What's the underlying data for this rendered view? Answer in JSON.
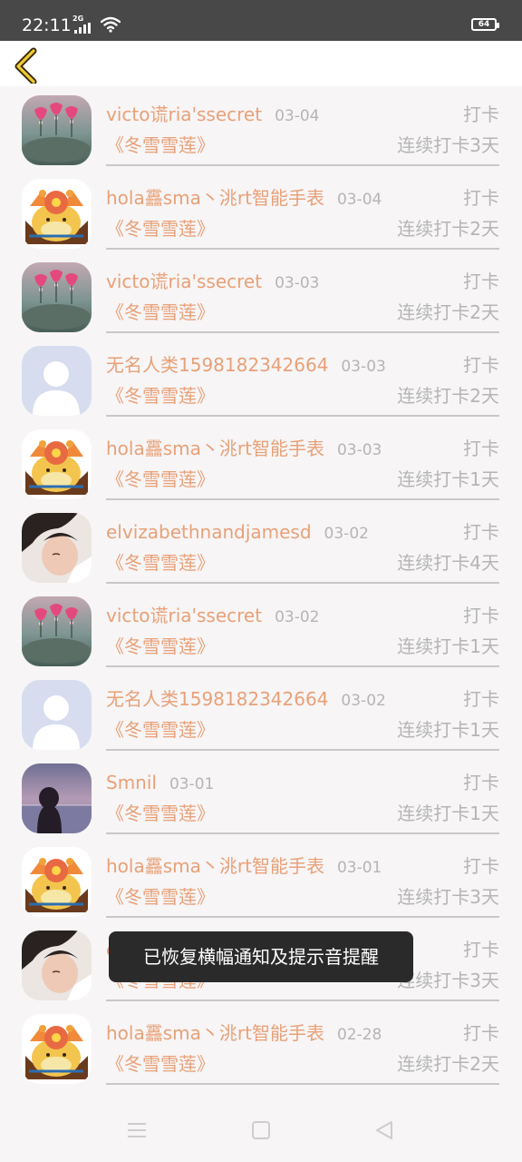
{
  "status_bar": {
    "time": "22:11",
    "network": "2G",
    "battery": "64"
  },
  "toast": "已恢复横幅通知及提示音提醒",
  "colors": {
    "accent": "#e8a178",
    "muted": "#b5b5b5",
    "toast_bg": "#2a2a2a",
    "status_bar": "#484848"
  },
  "entries": [
    {
      "avatar": "pink-flowers-avatar",
      "name": "victo谎ria'ssecret",
      "date": "03-04",
      "action": "打卡",
      "book": "《冬雪雪莲》",
      "streak": "连续打卡3天"
    },
    {
      "avatar": "cartoon-cat-avatar",
      "name": "hola靐sma丶洮rt智能手表",
      "date": "03-04",
      "action": "打卡",
      "book": "《冬雪雪莲》",
      "streak": "连续打卡2天"
    },
    {
      "avatar": "pink-flowers-avatar",
      "name": "victo谎ria'ssecret",
      "date": "03-03",
      "action": "打卡",
      "book": "《冬雪雪莲》",
      "streak": "连续打卡2天"
    },
    {
      "avatar": "default-person-avatar",
      "name": "无名人类1598182342664",
      "date": "03-03",
      "action": "打卡",
      "book": "《冬雪雪莲》",
      "streak": "连续打卡2天"
    },
    {
      "avatar": "cartoon-cat-avatar",
      "name": "hola靐sma丶洮rt智能手表",
      "date": "03-03",
      "action": "打卡",
      "book": "《冬雪雪莲》",
      "streak": "连续打卡1天"
    },
    {
      "avatar": "boy-photo-avatar",
      "name": "elvizabethnandjamesd",
      "date": "03-02",
      "action": "打卡",
      "book": "《冬雪雪莲》",
      "streak": "连续打卡4天"
    },
    {
      "avatar": "pink-flowers-avatar",
      "name": "victo谎ria'ssecret",
      "date": "03-02",
      "action": "打卡",
      "book": "《冬雪雪莲》",
      "streak": "连续打卡1天"
    },
    {
      "avatar": "default-person-avatar",
      "name": "无名人类1598182342664",
      "date": "03-02",
      "action": "打卡",
      "book": "《冬雪雪莲》",
      "streak": "连续打卡1天"
    },
    {
      "avatar": "girl-sea-avatar",
      "name": "Smnil",
      "date": "03-01",
      "action": "打卡",
      "book": "《冬雪雪莲》",
      "streak": "连续打卡1天"
    },
    {
      "avatar": "cartoon-cat-avatar",
      "name": "hola靐sma丶洮rt智能手表",
      "date": "03-01",
      "action": "打卡",
      "book": "《冬雪雪莲》",
      "streak": "连续打卡3天"
    },
    {
      "avatar": "boy-photo-avatar",
      "name": "el",
      "date": "",
      "action": "打卡",
      "book": "《冬雪雪莲》",
      "streak": "连续打卡3天"
    },
    {
      "avatar": "cartoon-cat-avatar",
      "name": "hola靐sma丶洮rt智能手表",
      "date": "02-28",
      "action": "打卡",
      "book": "《冬雪雪莲》",
      "streak": "连续打卡2天"
    }
  ]
}
